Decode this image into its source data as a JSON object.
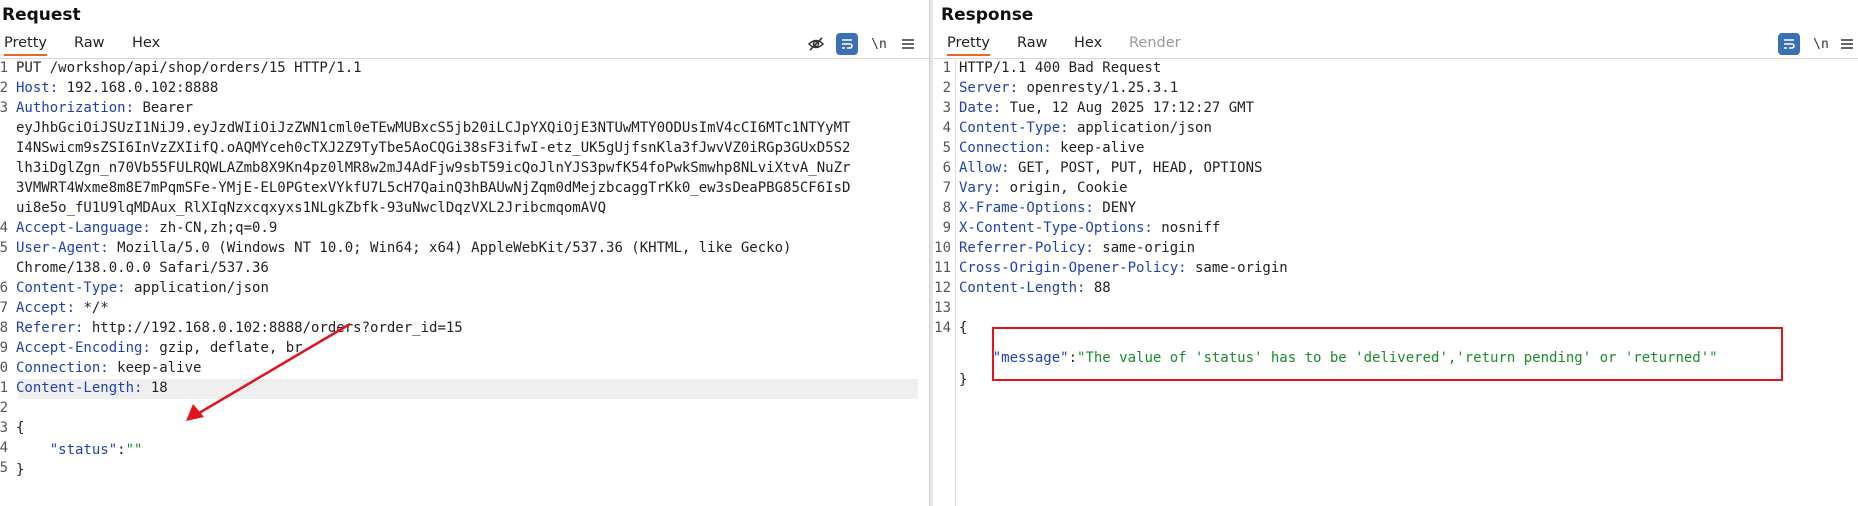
{
  "request": {
    "title": "Request",
    "tabs": [
      "Pretty",
      "Raw",
      "Hex"
    ],
    "lines": [
      {
        "n": "1",
        "text": "PUT /workshop/api/shop/orders/15 HTTP/1.1"
      },
      {
        "n": "2",
        "key": "Host:",
        "val": " 192.168.0.102:8888"
      },
      {
        "n": "3",
        "key": "Authorization:",
        "val": " Bearer"
      },
      {
        "n": "",
        "text": "eyJhbGciOiJSUzI1NiJ9.eyJzdWIiOiJzZWN1cml0eTEwMUBxcS5jb20iLCJpYXQiOjE3NTUwMTY0ODUsImV4cCI6MTc1NTYyMT"
      },
      {
        "n": "",
        "text": "I4NSwicm9sZSI6InVzZXIifQ.oAQMYceh0cTXJ2Z9TyTbe5AoCQGi38sF3ifwI-etz_UK5gUjfsnKla3fJwvVZ0iRGp3GUxD5S2"
      },
      {
        "n": "",
        "text": "lh3iDglZgn_n70Vb55FULRQWLAZmb8X9Kn4pz0lMR8w2mJ4AdFjw9sbT59icQoJlnYJS3pwfK54foPwkSmwhp8NLviXtvA_NuZr"
      },
      {
        "n": "",
        "text": "3VMWRT4Wxme8m8E7mPqmSFe-YMjE-EL0PGtexVYkfU7L5cH7QainQ3hBAUwNjZqm0dMejzbcaggTrKk0_ew3sDeaPBG85CF6IsD"
      },
      {
        "n": "",
        "text": "ui8e5o_fU1U9lqMDAux_RlXIqNzxcqxyxs1NLgkZbfk-93uNwclDqzVXL2JribcmqomAVQ"
      },
      {
        "n": "4",
        "key": "Accept-Language:",
        "val": " zh-CN,zh;q=0.9"
      },
      {
        "n": "5",
        "key": "User-Agent:",
        "val": " Mozilla/5.0 (Windows NT 10.0; Win64; x64) AppleWebKit/537.36 (KHTML, like Gecko)"
      },
      {
        "n": "",
        "text": "Chrome/138.0.0.0 Safari/537.36"
      },
      {
        "n": "6",
        "key": "Content-Type:",
        "val": " application/json"
      },
      {
        "n": "7",
        "key": "Accept:",
        "val": " */*"
      },
      {
        "n": "8",
        "key": "Referer:",
        "val": " http://192.168.0.102:8888/orders?order_id=15"
      },
      {
        "n": "9",
        "key": "Accept-Encoding:",
        "val": " gzip, deflate, br"
      },
      {
        "n": "0",
        "key": "Connection:",
        "val": " keep-alive"
      },
      {
        "n": "1",
        "key": "Content-Length:",
        "val": " 18"
      },
      {
        "n": "2",
        "text": ""
      },
      {
        "n": "3",
        "text": "{"
      },
      {
        "n": "4",
        "body_key": "    \"status\"",
        "body_colon": ":",
        "body_val": "\"\""
      },
      {
        "n": "5",
        "text": "}"
      }
    ]
  },
  "response": {
    "title": "Response",
    "tabs": [
      "Pretty",
      "Raw",
      "Hex",
      "Render"
    ],
    "lines": [
      {
        "n": "1",
        "text": "HTTP/1.1 400 Bad Request"
      },
      {
        "n": "2",
        "key": "Server:",
        "val": " openresty/1.25.3.1"
      },
      {
        "n": "3",
        "key": "Date:",
        "val": " Tue, 12 Aug 2025 17:12:27 GMT"
      },
      {
        "n": "4",
        "key": "Content-Type:",
        "val": " application/json"
      },
      {
        "n": "5",
        "key": "Connection:",
        "val": " keep-alive"
      },
      {
        "n": "6",
        "key": "Allow:",
        "val": " GET, POST, PUT, HEAD, OPTIONS"
      },
      {
        "n": "7",
        "key": "Vary:",
        "val": " origin, Cookie"
      },
      {
        "n": "8",
        "key": "X-Frame-Options:",
        "val": " DENY"
      },
      {
        "n": "9",
        "key": "X-Content-Type-Options:",
        "val": " nosniff"
      },
      {
        "n": "10",
        "key": "Referrer-Policy:",
        "val": " same-origin"
      },
      {
        "n": "11",
        "key": "Cross-Origin-Opener-Policy:",
        "val": " same-origin"
      },
      {
        "n": "12",
        "key": "Content-Length:",
        "val": " 88"
      },
      {
        "n": "13",
        "text": ""
      },
      {
        "n": "14",
        "text": "{"
      },
      {
        "n": "",
        "body_key": "    \"message\"",
        "body_colon": ":",
        "body_val": "\"The value of 'status' has to be 'delivered','return pending' or 'returned'\""
      },
      {
        "n": "",
        "text": "}"
      }
    ]
  },
  "colors": {
    "header_key": "#1f3fb8",
    "json_string": "#1a8a2a",
    "annotation": "#e3141f",
    "tab_accent": "#e8662b"
  }
}
